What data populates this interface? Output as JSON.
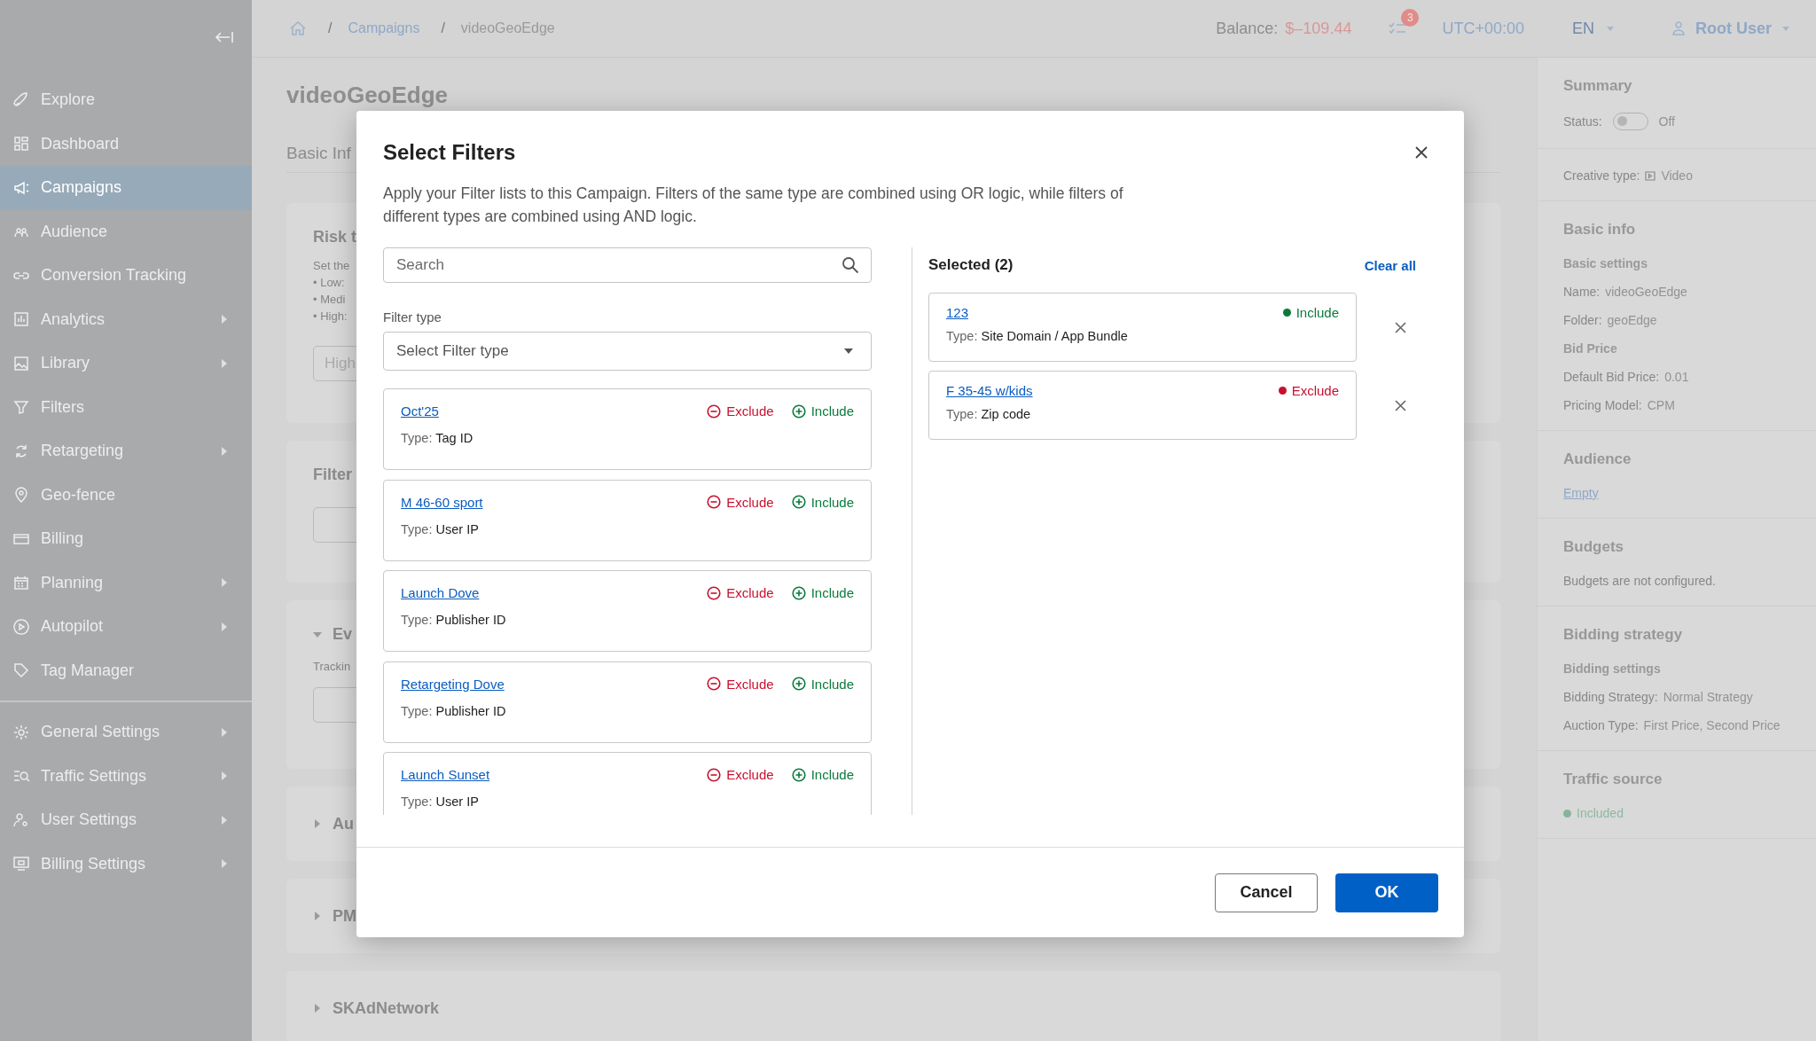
{
  "sidebar": {
    "items": [
      {
        "label": "Explore",
        "selected": false,
        "submenu": false
      },
      {
        "label": "Dashboard",
        "selected": false,
        "submenu": false
      },
      {
        "label": "Campaigns",
        "selected": true,
        "submenu": false
      },
      {
        "label": "Audience",
        "selected": false,
        "submenu": false
      },
      {
        "label": "Conversion Tracking",
        "selected": false,
        "submenu": false
      },
      {
        "label": "Analytics",
        "selected": false,
        "submenu": true
      },
      {
        "label": "Library",
        "selected": false,
        "submenu": true
      },
      {
        "label": "Filters",
        "selected": false,
        "submenu": false
      },
      {
        "label": "Retargeting",
        "selected": false,
        "submenu": true
      },
      {
        "label": "Geo-fence",
        "selected": false,
        "submenu": false
      },
      {
        "label": "Billing",
        "selected": false,
        "submenu": false
      },
      {
        "label": "Planning",
        "selected": false,
        "submenu": true
      },
      {
        "label": "Autopilot",
        "selected": false,
        "submenu": true
      },
      {
        "label": "Tag Manager",
        "selected": false,
        "submenu": false
      }
    ],
    "settings_items": [
      {
        "label": "General Settings",
        "selected": false,
        "submenu": true
      },
      {
        "label": "Traffic Settings",
        "selected": false,
        "submenu": true
      },
      {
        "label": "User Settings",
        "selected": false,
        "submenu": true
      },
      {
        "label": "Billing Settings",
        "selected": false,
        "submenu": true
      }
    ]
  },
  "topbar": {
    "breadcrumbs": [
      {
        "separator": "/",
        "label": "Campaigns",
        "kind": "link"
      },
      {
        "separator": "/",
        "label": "videoGeoEdge",
        "kind": "current"
      }
    ],
    "balance_label": "Balance:",
    "balance": "$–109.44",
    "tasks_badge": "3",
    "timezone": "UTC+00:00",
    "language": "EN",
    "user": "Root User"
  },
  "page": {
    "title": "videoGeoEdge",
    "tab": "Basic Inf",
    "sections": [
      {
        "kind": "risk",
        "heading": "Risk t",
        "text": "Set the",
        "bullets": [
          "• Low:",
          "• Medi",
          "• High:"
        ],
        "select": "High"
      },
      {
        "kind": "field",
        "heading": "Filter"
      },
      {
        "kind": "collapsible",
        "heading": "Ev",
        "expanded": true,
        "label": "Trackin"
      },
      {
        "kind": "collapsible",
        "heading": "Au",
        "expanded": false
      },
      {
        "kind": "collapsible",
        "heading": "PM",
        "expanded": false
      },
      {
        "kind": "collapsible",
        "heading": "SKAdNetwork",
        "expanded": false
      }
    ]
  },
  "summary": {
    "sections": [
      {
        "heading": "Summary",
        "rows": [
          {
            "kind": "toggle",
            "label": "Status:",
            "on": false,
            "value": "Off"
          }
        ]
      },
      {
        "rows": [
          {
            "kind": "media",
            "label": "Creative type:",
            "value": "Video"
          }
        ]
      },
      {
        "heading": "Basic info",
        "rows": [
          {
            "kind": "subheading",
            "text": "Basic settings"
          },
          {
            "kind": "field",
            "label": "Name:",
            "value": "videoGeoEdge"
          },
          {
            "kind": "field",
            "label": "Folder:",
            "value": "geoEdge"
          },
          {
            "kind": "subheading",
            "text": "Bid Price"
          },
          {
            "kind": "field",
            "label": "Default Bid Price:",
            "value": "0.01"
          },
          {
            "kind": "field",
            "label": "Pricing Model:",
            "value": "CPM"
          }
        ]
      },
      {
        "heading": "Audience",
        "rows": [
          {
            "kind": "link",
            "text": "Empty"
          }
        ]
      },
      {
        "heading": "Budgets",
        "rows": [
          {
            "kind": "note",
            "text": "Budgets are not configured."
          }
        ]
      },
      {
        "heading": "Bidding strategy",
        "rows": [
          {
            "kind": "subheading",
            "text": "Bidding settings"
          },
          {
            "kind": "field",
            "label": "Bidding Strategy:",
            "value": "Normal Strategy"
          },
          {
            "kind": "field",
            "label": "Auction Type:",
            "value": "First Price, Second Price"
          }
        ]
      },
      {
        "heading": "Traffic source",
        "rows": [
          {
            "kind": "status",
            "text": "Included",
            "color": "#86b39a"
          }
        ]
      }
    ]
  },
  "dialog": {
    "title": "Select Filters",
    "description": "Apply your Filter lists to this Campaign. Filters of the same type are combined using OR logic, while filters of different types are combined using AND logic.",
    "search": {
      "placeholder": "Search"
    },
    "filter_type": {
      "label": "Filter type",
      "placeholder": "Select Filter type"
    },
    "filters": [
      {
        "name": "Oct'25",
        "type_label": "Type:",
        "type": "Tag ID",
        "exclude": "Exclude",
        "include": "Include"
      },
      {
        "name": "M 46-60 sport",
        "type_label": "Type:",
        "type": "User IP",
        "exclude": "Exclude",
        "include": "Include"
      },
      {
        "name": "Launch Dove",
        "type_label": "Type:",
        "type": "Publisher ID",
        "exclude": "Exclude",
        "include": "Include"
      },
      {
        "name": "Retargeting Dove",
        "type_label": "Type:",
        "type": "Publisher ID",
        "exclude": "Exclude",
        "include": "Include"
      },
      {
        "name": "Launch Sunset",
        "type_label": "Type:",
        "type": "User IP",
        "exclude": "Exclude",
        "include": "Include"
      }
    ],
    "selected_title": "Selected (2)",
    "clear_all": "Clear all",
    "selected": [
      {
        "name": "123",
        "type_label": "Type:",
        "type": "Site Domain / App Bundle",
        "kind": "include",
        "mode": "Include"
      },
      {
        "name": "F 35-45 w/kids",
        "type_label": "Type:",
        "type": "Zip code",
        "kind": "exclude",
        "mode": "Exclude"
      }
    ],
    "cancel": "Cancel",
    "ok": "OK"
  }
}
